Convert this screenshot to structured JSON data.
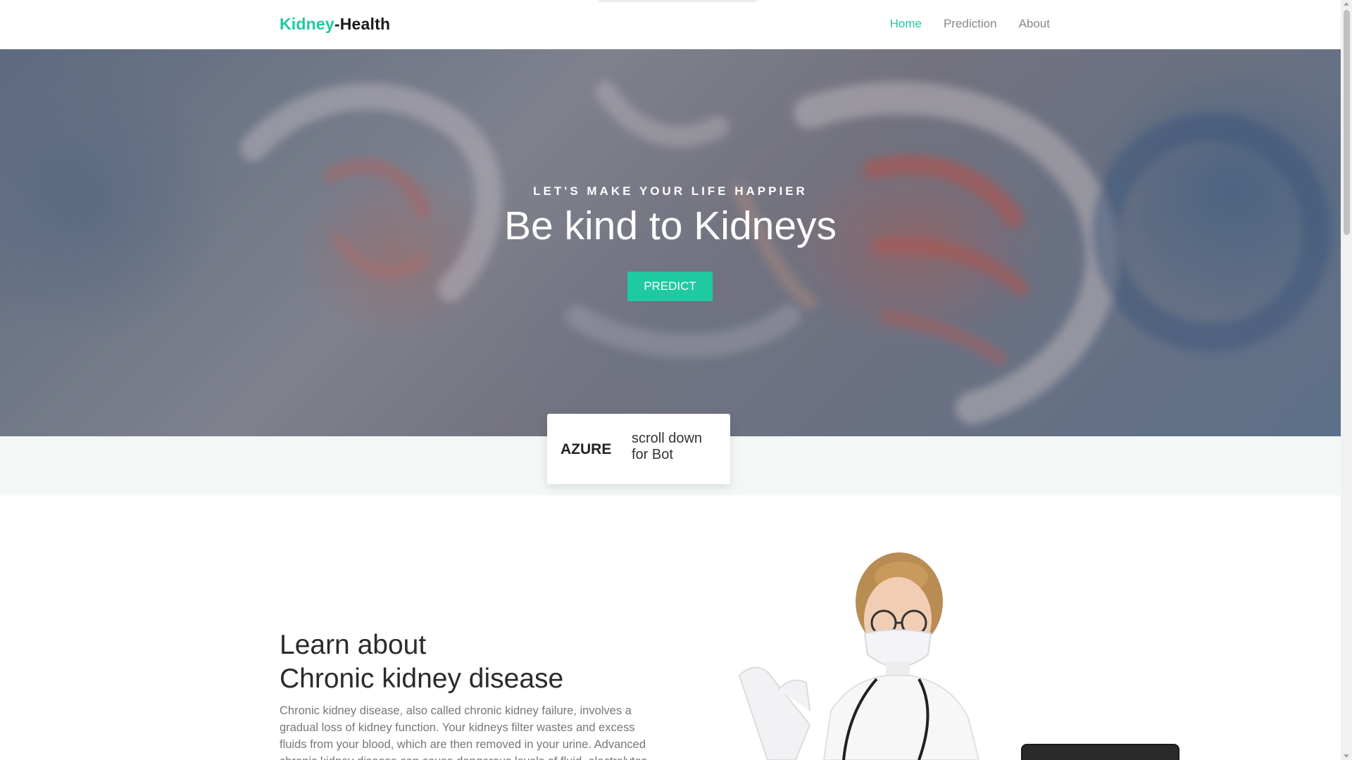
{
  "navbar": {
    "brand_part1": "Kidney",
    "brand_part2": "-Health",
    "links": [
      {
        "label": "Home",
        "active": true
      },
      {
        "label": "Prediction",
        "active": false
      },
      {
        "label": "About",
        "active": false
      }
    ]
  },
  "hero": {
    "subtitle": "LET'S MAKE YOUR LIFE HAPPIER",
    "title": "Be kind to Kidneys",
    "button_label": "PREDICT"
  },
  "azure_card": {
    "label": "AZURE",
    "text": "scroll down for Bot"
  },
  "learn": {
    "title_line1": "Learn about",
    "title_line2": "Chronic kidney disease",
    "text": "Chronic kidney disease, also called chronic kidney failure, involves a gradual loss of kidney function. Your kidneys filter wastes and excess fluids from your blood, which are then removed in your urine. Advanced chronic kidney disease can cause dangerous levels of fluid, electrolytes and wastes to build up in your body."
  },
  "colors": {
    "accent": "#1fc9a1",
    "strip": "#f3f8f6"
  }
}
